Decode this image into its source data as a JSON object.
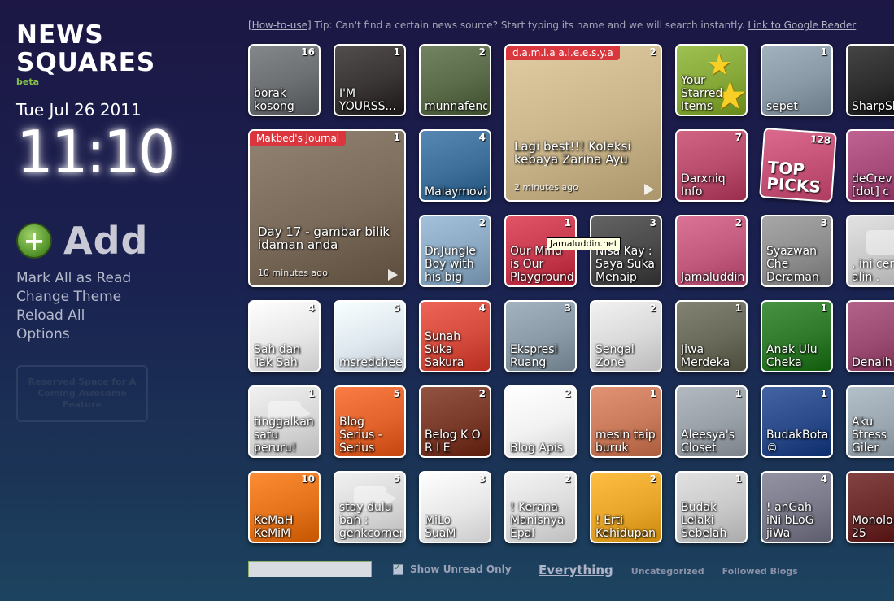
{
  "brand": {
    "line1": "NEWS",
    "line2": "SQUARES",
    "badge": "beta"
  },
  "clock": {
    "date": "Tue Jul 26 2011",
    "time": "11:10"
  },
  "sidebar": {
    "add_label": "Add",
    "menu": [
      "Mark All as Read",
      "Change Theme",
      "Reload All",
      "Options"
    ],
    "reserved": "Reserved Space for A Coming Awesome Feature"
  },
  "tip": {
    "howto": "[How-to-use]",
    "text": " Tip: Can't find a certain news source? Start typing its name and we will search instantly. ",
    "link": "Link to Google Reader"
  },
  "tiles": [
    {
      "title": "borak\nkosong",
      "count": "16",
      "color": "#6b6f72"
    },
    {
      "title": "I'M\nYOURSS...",
      "count": "1",
      "color": "#3a3535"
    },
    {
      "title": "munnafend",
      "count": "2",
      "color": "#5a6b4a"
    },
    {
      "title": "Lagi best!!! Koleksi\nkebaya Zarina Ayu",
      "count": "2",
      "ribbon": "d.a.m.i.a a.l.e.e.s.y.a",
      "ago": "2 minutes ago",
      "color": "#c9b48a"
    },
    {
      "title": "Your\nStarred\nItems",
      "count": "",
      "color": "#86a838"
    },
    {
      "title": "sepet",
      "count": "1",
      "color": "#8a99a6"
    },
    {
      "title": "SharpSh",
      "count": "",
      "color": "#2c2c2c"
    },
    {
      "title": "Day 17 - gambar bilik\nidaman anda",
      "count": "1",
      "ribbon": "Makbed's Journal",
      "ago": "10 minutes ago",
      "color": "#7a6a5a"
    },
    {
      "title": "Malaymovie",
      "count": "4",
      "color": "#3d6f9a"
    },
    {
      "title": "Darxniq\nInfo",
      "count": "7",
      "color": "#b84b6b"
    },
    {
      "title": "TOP\nPICKS",
      "count": "128",
      "color": "#c8557a"
    },
    {
      "title": "deCrev\n[dot] c",
      "count": "",
      "color": "#a64a7a"
    },
    {
      "title": "Dr.Jungle\nBoy with\nhis big",
      "count": "2",
      "color": "#8aa8c2"
    },
    {
      "title": "Our Mind\nis Our\nPlayground",
      "count": "1",
      "color": "#c83a4e"
    },
    {
      "title": "Nisa Kay :\nSaya Suka\nMenaip",
      "count": "3",
      "color": "#4a4a4a"
    },
    {
      "title": "Jamaluddin",
      "count": "2",
      "color": "#c25a7d"
    },
    {
      "title": "Syazwan\nChe\nDeraman",
      "count": "3",
      "color": "#8e8e8e"
    },
    {
      "title": ". ini cer\nalin .",
      "count": "",
      "color": "#c9c9c9"
    },
    {
      "title": "Sah dan\nTak Sah",
      "count": "4",
      "color": "#e8e8e8"
    },
    {
      "title": "msredcheek",
      "count": "5",
      "color": "#dfe8ef"
    },
    {
      "title": "Sunah\nSuka\nSakura",
      "count": "4",
      "color": "#d54c3e"
    },
    {
      "title": "Ekspresi\nRuang",
      "count": "3",
      "color": "#8a9aa6"
    },
    {
      "title": "Sengal\nZone",
      "count": "2",
      "color": "#d9d9d9"
    },
    {
      "title": "Jiwa\nMerdeka",
      "count": "1",
      "color": "#6a6a5a"
    },
    {
      "title": "Anak Ulu\nCheka",
      "count": "1",
      "color": "#2f7a2a"
    },
    {
      "title": "Denaih",
      "count": "",
      "color": "#9a4a70"
    },
    {
      "title": "tinggalkan\nsatu\nperuru!",
      "count": "1",
      "color": "#d8d8d8"
    },
    {
      "title": "Blog\nSerius -\nSerius",
      "count": "5",
      "color": "#e2642c"
    },
    {
      "title": "Belog K O\nR I E",
      "count": "2",
      "color": "#7a3a2a"
    },
    {
      "title": "Blog Apis",
      "count": "2",
      "color": "#f2f2f2"
    },
    {
      "title": "mesin taip\nburuk",
      "count": "1",
      "color": "#c97a5a"
    },
    {
      "title": "Aleesya's\nCloset",
      "count": "1",
      "color": "#9aa0a8"
    },
    {
      "title": "BudakBota\n©",
      "count": "1",
      "color": "#2a4a8a"
    },
    {
      "title": "Aku\nStress\nGiler",
      "count": "",
      "color": "#9aa6b0"
    },
    {
      "title": "KeMaH\nKeMiM",
      "count": "10",
      "color": "#e4731c"
    },
    {
      "title": "stay dulu\nbah :\ngenkcorner",
      "count": "5",
      "color": "#d8d8d8"
    },
    {
      "title": "MiLo\nSuaM",
      "count": "3",
      "color": "#e8e8e8"
    },
    {
      "title": "! Kerana\nManisnya\nEpal",
      "count": "2",
      "color": "#dcdcdc"
    },
    {
      "title": "! Erti\nKehidupan",
      "count": "2",
      "color": "#e8a62a"
    },
    {
      "title": "Budak\nLelaki\nSebelah",
      "count": "1",
      "color": "#c9c9c9"
    },
    {
      "title": "! anGah\niNi bLoG\njiWa",
      "count": "4",
      "color": "#7a7a8a"
    },
    {
      "title": "Monolo\n25",
      "count": "",
      "color": "#6a2a2a"
    }
  ],
  "tooltip": "Jamaluddin.net",
  "bottom": {
    "show_unread": "Show Unread Only",
    "tabs": [
      "Everything",
      "Uncategorized",
      "Followed Blogs"
    ]
  }
}
